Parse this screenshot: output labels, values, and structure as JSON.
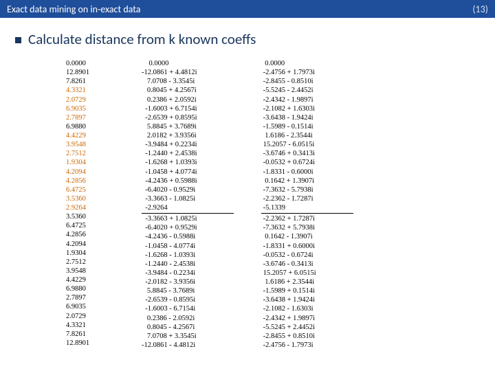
{
  "titlebar": {
    "title": "Exact data mining on in-exact data",
    "pagenum": "(13)"
  },
  "heading": "Calculate distance from k known coeffs",
  "col_left": {
    "part1": "0.0000\n12.8901\n7.8261",
    "hl1": "4.3321\n2.0729\n6.9035\n2.7897",
    "part2": "6.9880",
    "hl2": "4.4229\n3.9548\n2.7512\n1.9304\n4.2094\n4.2856\n6.4725\n3.5360\n2.9264",
    "part3": "3.5360\n6.4725\n4.2856\n4.2094\n1.9304\n2.7512\n3.9548\n4.4229\n6.9880\n2.7897\n6.9035\n2.0729\n4.3321\n7.8261\n12.8901"
  },
  "col_mid": {
    "top": "    0.0000\n-12.0861 + 4.4812i\n   7.0708 - 3.3545i\n   0.8045 + 4.2567i\n   0.2386 + 2.0592i\n  -1.6003 + 6.7154i\n  -2.6539 + 0.8595i\n   5.8845 + 3.7689i\n   2.0182 + 3.9356i\n  -3.9484 + 0.2234i\n  -1.2440 + 2.4538i\n  -1.6268 + 1.0393i\n  -1.0458 + 4.0774i\n  -4.2436 + 0.5988i\n  -6.4020 - 0.9529i\n  -3.3663 - 1.0825i\n  -2.9264",
    "bot": "  -3.3663 + 1.0825i\n  -6.4020 + 0.9529i\n  -4.2436 - 0.5988i\n  -1.0458 - 4.0774i\n  -1.6268 - 1.0393i\n  -1.2440 - 2.4538i\n  -3.9484 - 0.2234i\n  -2.0182 - 3.9356i\n   5.8845 - 3.7689i\n  -2.6539 - 0.8595i\n  -1.6003 - 6.7154i\n   0.2386 - 2.0592i\n   0.8045 - 4.2567i\n   7.0708 + 3.3545i\n-12.0861 - 4.4812i"
  },
  "col_right": {
    "top": "  0.0000\n -2.4756 + 1.7973i\n -2.8455 - 0.8510i\n -5.5245 - 2.4452i\n -2.4342 - 1.9897i\n -2.1082 + 1.6303i\n -3.6438 - 1.9424i\n -1.5989 - 0.1514i\n  1.6186 - 2.3544i\n 15.2057 - 6.0515i\n -3.6746 + 0.3413i\n -0.0532 + 0.6724i\n -1.8331 - 0.6000i\n  0.1642 + 1.3907i\n -7.3632 - 5.7938i\n -2.2362 - 1.7287i\n -5.1339",
    "bot": " -2.2362 + 1.7287i\n -7.3632 + 5.7938i\n  0.1642 - 1.3907i\n -1.8331 + 0.6000i\n -0.0532 - 0.6724i\n -3.6746 - 0.3413i\n 15.2057 + 6.0515i\n  1.6186 + 2.3544i\n -1.5989 + 0.1514i\n -3.6438 + 1.9424i\n -2.1082 - 1.6303i\n -2.4342 + 1.9897i\n -5.5245 + 2.4452i\n -2.8455 + 0.8510i\n -2.4756 - 1.7973i"
  }
}
